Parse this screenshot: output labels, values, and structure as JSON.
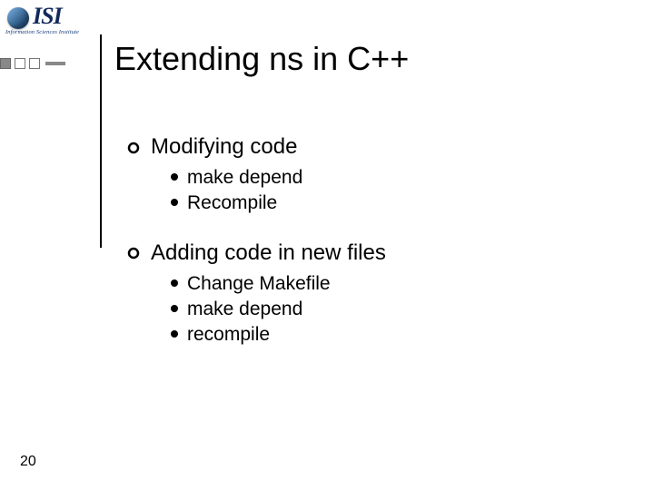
{
  "logo": {
    "text": "ISI",
    "subtitle": "Information Sciences Institute"
  },
  "title": "Extending ns in C++",
  "sections": [
    {
      "heading": "Modifying code",
      "items": [
        "make depend",
        "Recompile"
      ]
    },
    {
      "heading": "Adding code in new files",
      "items": [
        "Change Makefile",
        "make depend",
        "recompile"
      ]
    }
  ],
  "page_number": "20"
}
